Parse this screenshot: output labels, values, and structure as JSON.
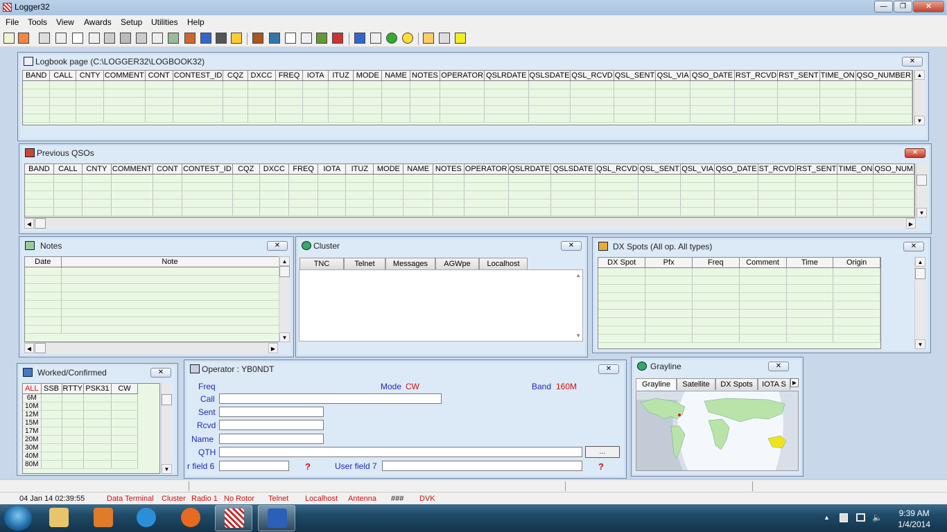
{
  "app": {
    "title": "Logger32",
    "min": "—",
    "max": "❐",
    "close": "✕"
  },
  "menu": [
    "File",
    "Tools",
    "View",
    "Awards",
    "Setup",
    "Utilities",
    "Help"
  ],
  "logbook": {
    "title": "Logbook page (C:\\LOGGER32\\LOGBOOK32)",
    "close": "✕",
    "columns": [
      "BAND",
      "CALL",
      "CNTY",
      "COMMENT",
      "CONT",
      "CONTEST_ID",
      "CQZ",
      "DXCC",
      "FREQ",
      "IOTA",
      "ITUZ",
      "MODE",
      "NAME",
      "NOTES",
      "OPERATOR",
      "QSLRDATE",
      "QSLSDATE",
      "QSL_RCVD",
      "QSL_SENT",
      "QSL_VIA",
      "QSO_DATE",
      "RST_RCVD",
      "RST_SENT",
      "TIME_ON",
      "QSO_NUMBER"
    ]
  },
  "previous": {
    "title": "Previous QSOs",
    "close": "✕",
    "columns": [
      "BAND",
      "CALL",
      "CNTY",
      "COMMENT",
      "CONT",
      "CONTEST_ID",
      "CQZ",
      "DXCC",
      "FREQ",
      "IOTA",
      "ITUZ",
      "MODE",
      "NAME",
      "NOTES",
      "OPERATOR",
      "QSLRDATE",
      "QSLSDATE",
      "QSL_RCVD",
      "QSL_SENT",
      "QSL_VIA",
      "QSO_DATE",
      "ST_RCVD",
      "RST_SENT",
      "TIME_ON",
      "QSO_NUM"
    ]
  },
  "notes": {
    "title": "Notes",
    "close": "✕",
    "columns": [
      "Date",
      "Note"
    ]
  },
  "cluster": {
    "title": "Cluster",
    "close": "✕",
    "tabs": [
      "TNC",
      "Telnet",
      "Messages",
      "AGWpe",
      "Localhost"
    ]
  },
  "dxspots": {
    "title": "DX Spots (All op. All types)",
    "close": "✕",
    "columns": [
      "DX Spot",
      "Pfx",
      "Freq",
      "Comment",
      "Time",
      "Origin"
    ]
  },
  "worked": {
    "title": "Worked/Confirmed",
    "close": "✕",
    "columns": [
      "ALL",
      "SSB",
      "RTTY",
      "PSK31",
      "CW"
    ],
    "bands": [
      "6M",
      "10M",
      "12M",
      "15M",
      "17M",
      "20M",
      "30M",
      "40M",
      "80M"
    ]
  },
  "operator": {
    "title": "Operator : YB0NDT",
    "close": "✕",
    "freq_label": "Freq",
    "mode_label": "Mode",
    "mode_value": "CW",
    "band_label": "Band",
    "band_value": "160M",
    "call_label": "Call",
    "sent_label": "Sent",
    "rcvd_label": "Rcvd",
    "name_label": "Name",
    "qth_label": "QTH",
    "qth_button": "...",
    "user6_label": "r field 6",
    "user7_label": "User field 7",
    "help_mark": "?"
  },
  "grayline": {
    "title": "Grayline",
    "close": "✕",
    "tabs": [
      "Grayline",
      "Satellite",
      "DX Spots",
      "IOTA S"
    ],
    "more": "▶"
  },
  "status": {
    "datetime": "04 Jan 14  02:39:55",
    "items": [
      "Data Terminal",
      "Cluster",
      "Radio 1",
      "No Rotor",
      "Telnet",
      "Localhost",
      "Antenna",
      "###",
      "DVK"
    ]
  },
  "taskbar": {
    "time": "9:39 AM",
    "date": "1/4/2014"
  },
  "colors": {
    "accent_red": "#d31010",
    "label_blue": "#1a2ab8",
    "grid_green": "#eaf7e4"
  }
}
